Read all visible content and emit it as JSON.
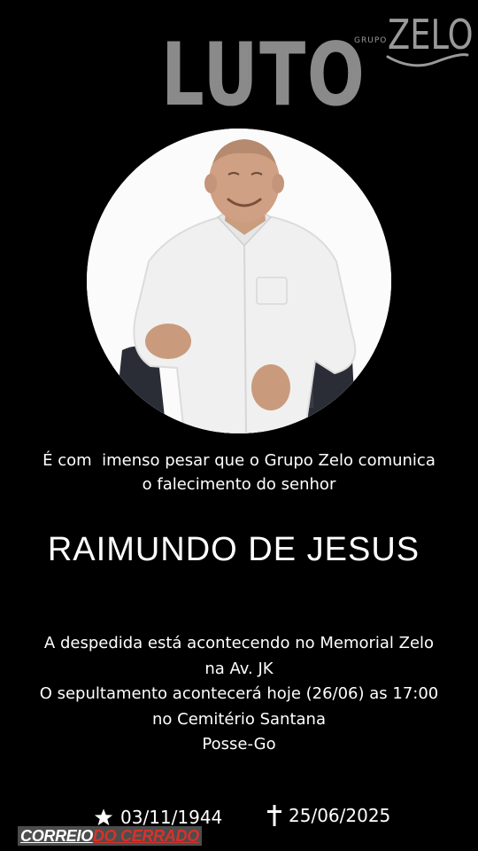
{
  "header": {
    "title": "LUTO",
    "logo_small": "GRUPO",
    "logo_big": "ZELO"
  },
  "photo": {
    "description_icon": "deceased-portrait"
  },
  "announcement": {
    "line1": "É com  imenso pesar que o Grupo Zelo comunica",
    "line2": "o falecimento do senhor"
  },
  "deceased": {
    "name": "RAIMUNDO DE JESUS"
  },
  "details": {
    "line1": "A despedida está acontecendo no Memorial Zelo",
    "line2": "na Av. JK",
    "line3": "O sepultamento acontecerá hoje (26/06) as 17:00",
    "line4": "no Cemitério Santana",
    "line5": "Posse-Go"
  },
  "dates": {
    "birth": "03/11/1944",
    "death": "25/06/2025",
    "birth_icon": "star-icon",
    "death_icon": "cross-icon"
  },
  "watermark": {
    "part1": "CORREIO",
    "part2": "DO CERRADO"
  },
  "colors": {
    "background": "#000000",
    "title_gray": "#8a8a8a",
    "text": "#ffffff",
    "watermark_red": "#d8322b"
  }
}
